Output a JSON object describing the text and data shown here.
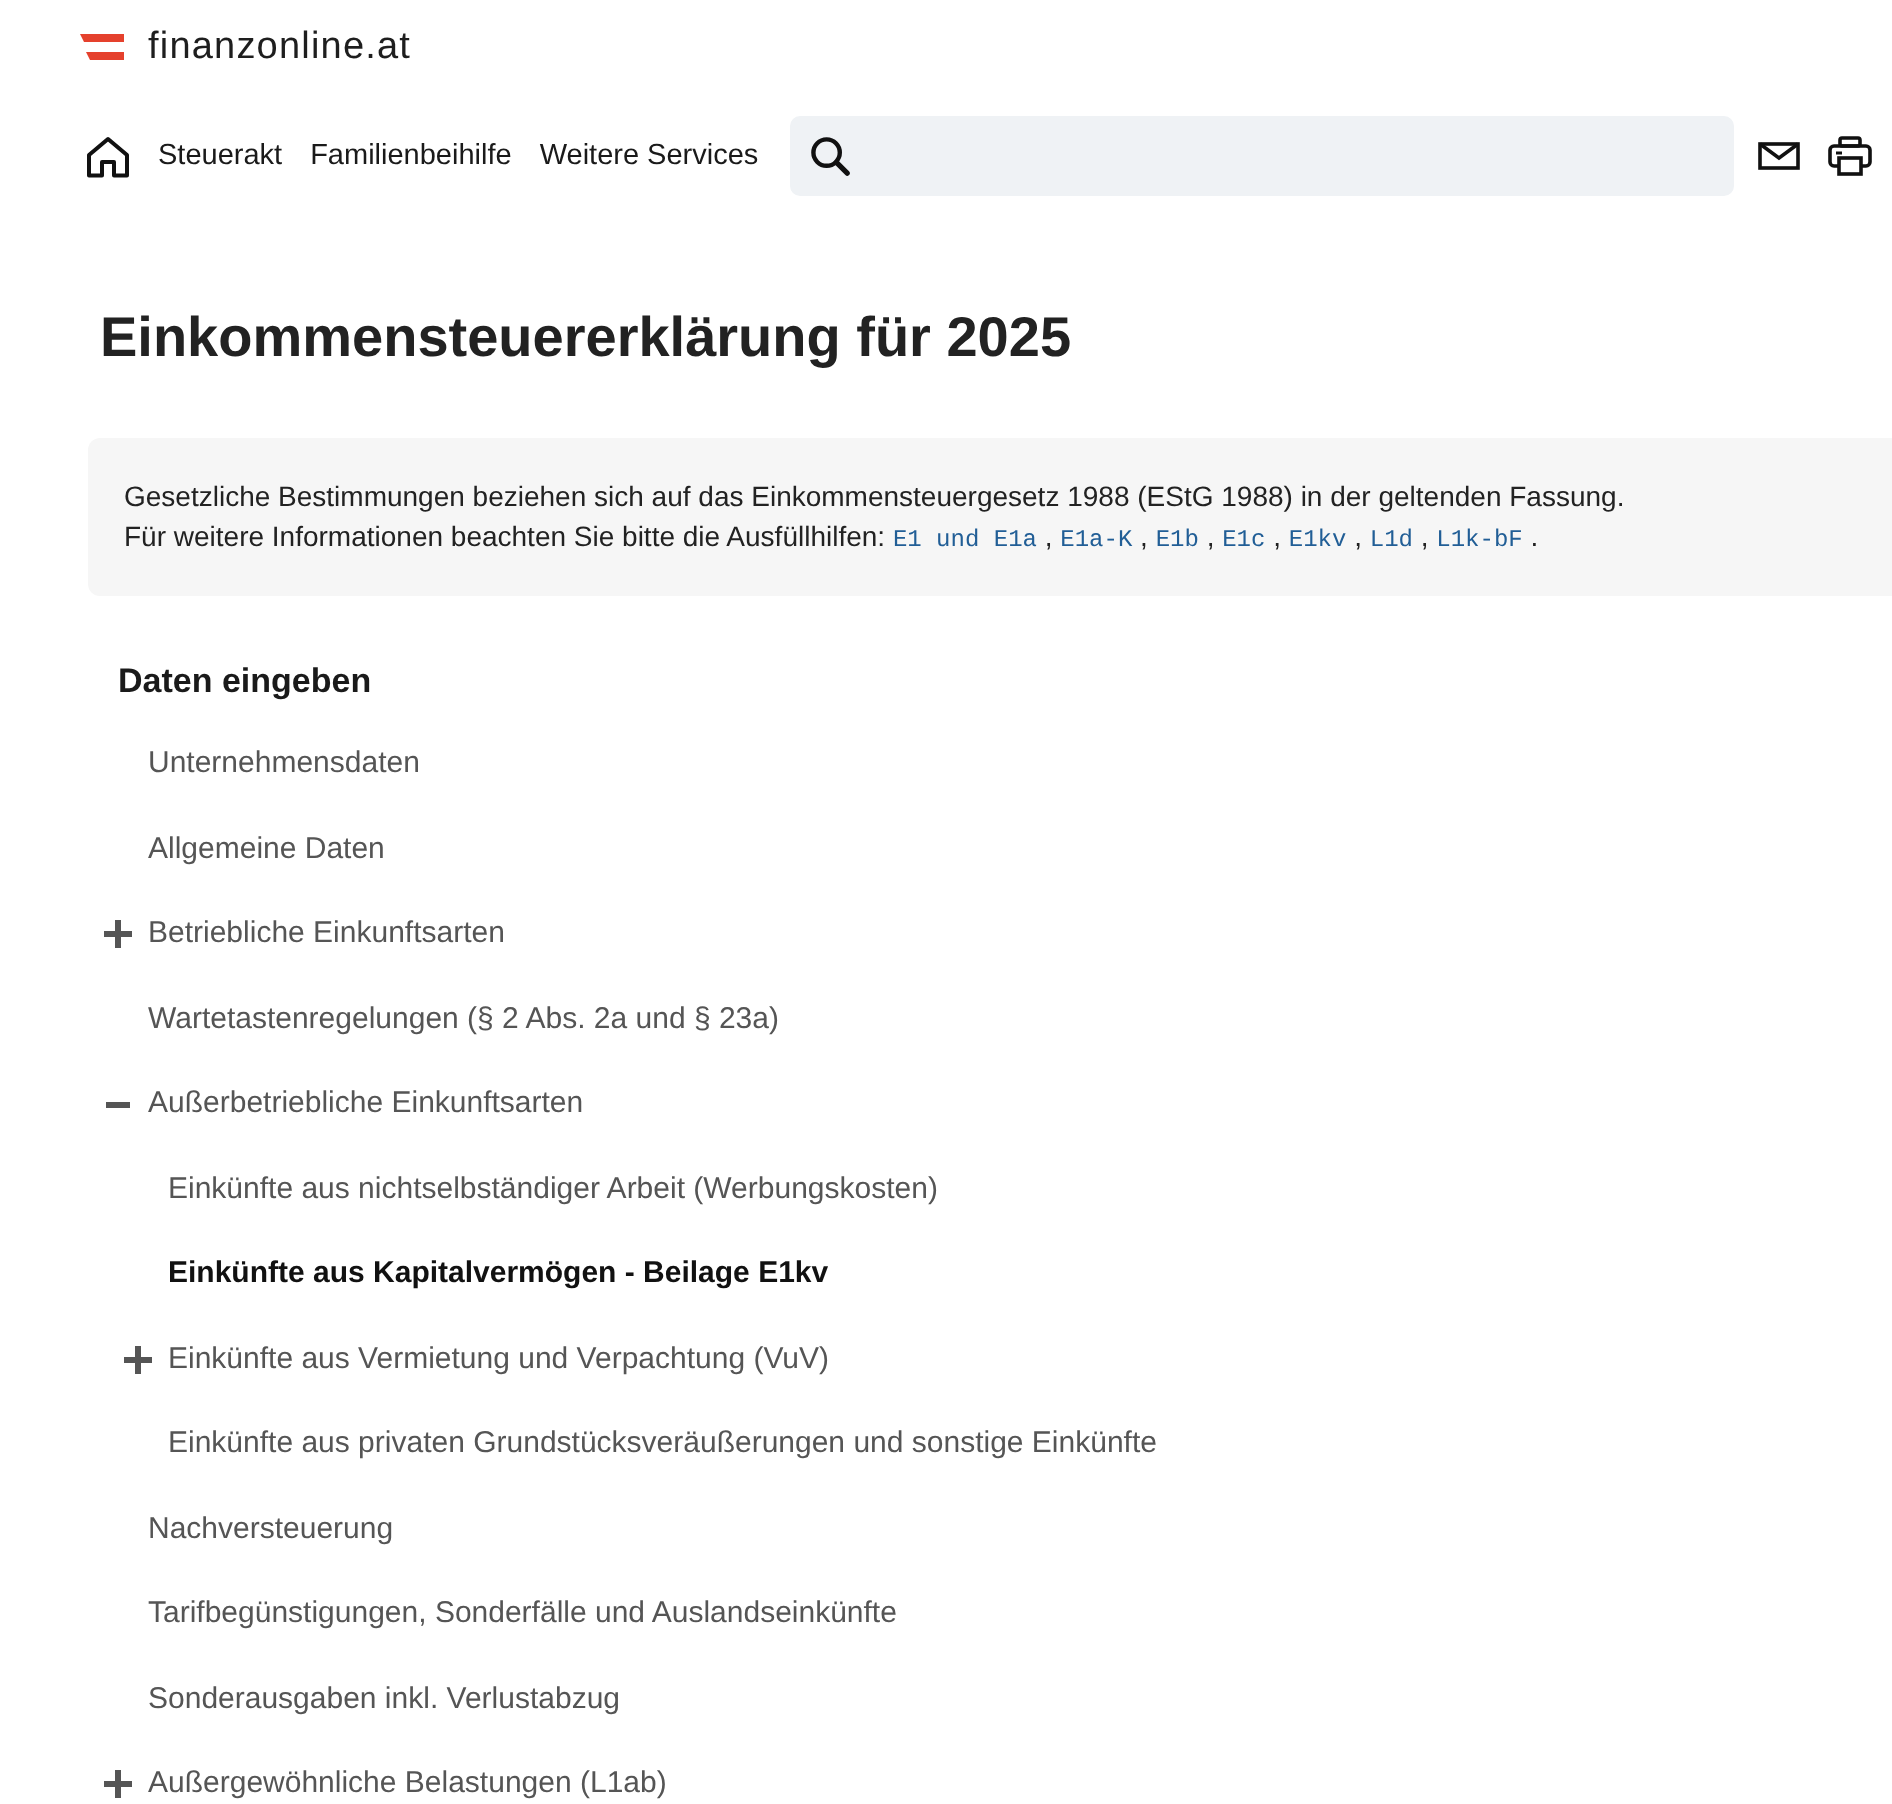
{
  "header": {
    "brand": "finanzonline.at",
    "nav": [
      "Steuerakt",
      "Familienbeihilfe",
      "Weitere Services"
    ]
  },
  "title": "Einkommensteuererklärung für 2025",
  "info": {
    "text": "Gesetzliche Bestimmungen beziehen sich auf das Einkommensteuergesetz 1988 (EStG 1988) in der geltenden Fassung.",
    "links_intro": "Für weitere Informationen beachten Sie bitte die Ausfüllhilfen:",
    "links": [
      "E1 und E1a",
      "E1a-K",
      "E1b",
      "E1c",
      "E1kv",
      "L1d",
      "L1k-bF"
    ],
    "separator": ",",
    "terminator": "."
  },
  "tree": {
    "title": "Daten eingeben",
    "items": [
      {
        "label": "Unternehmensdaten",
        "kind": "page",
        "selected": false
      },
      {
        "label": "Allgemeine Daten",
        "kind": "page",
        "selected": false
      },
      {
        "label": "Betriebliche Einkunftsarten",
        "kind": "group",
        "expanded": false,
        "selected": false
      },
      {
        "label": "Wartetastenregelungen (§ 2 Abs. 2a und § 23a)",
        "kind": "page",
        "selected": false
      },
      {
        "label": "Außerbetriebliche Einkunftsarten",
        "kind": "group",
        "expanded": true,
        "selected": false,
        "children": [
          {
            "label": "Einkünfte aus nichtselbständiger Arbeit (Werbungskosten)",
            "kind": "page",
            "selected": false
          },
          {
            "label": "Einkünfte aus Kapitalvermögen - Beilage E1kv",
            "kind": "page",
            "selected": true
          },
          {
            "label": "Einkünfte aus Vermietung und Verpachtung (VuV)",
            "kind": "group",
            "expanded": false,
            "selected": false
          },
          {
            "label": "Einkünfte aus privaten Grundstücksveräußerungen und sonstige Einkünfte",
            "kind": "page",
            "selected": false
          }
        ]
      },
      {
        "label": "Nachversteuerung",
        "kind": "page",
        "selected": false
      },
      {
        "label": "Tarifbegünstigungen, Sonderfälle und Auslandseinkünfte",
        "kind": "page",
        "selected": false
      },
      {
        "label": "Sonderausgaben inkl. Verlustabzug",
        "kind": "page",
        "selected": false
      },
      {
        "label": "Außergewöhnliche Belastungen (L1ab)",
        "kind": "group",
        "expanded": false,
        "selected": false
      }
    ]
  }
}
